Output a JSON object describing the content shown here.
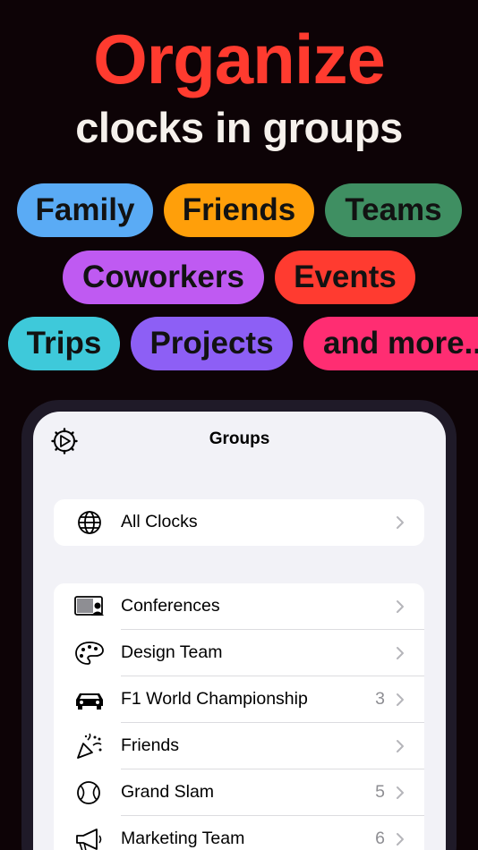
{
  "headline": "Organize",
  "subheadline": "clocks in groups",
  "tags": [
    {
      "label": "Family",
      "color": "#5aabf5"
    },
    {
      "label": "Friends",
      "color": "#ff9f0a"
    },
    {
      "label": "Teams",
      "color": "#3f8f62"
    },
    {
      "label": "Coworkers",
      "color": "#bf5af2"
    },
    {
      "label": "Events",
      "color": "#ff3b30"
    },
    {
      "label": "Trips",
      "color": "#3ec9da"
    },
    {
      "label": "Projects",
      "color": "#8d5ff5"
    },
    {
      "label": "and more...",
      "color": "#ff2d72"
    }
  ],
  "screen": {
    "title": "Groups",
    "settings_icon": "gear-clock-icon",
    "all_clocks": {
      "label": "All Clocks",
      "icon": "globe-icon"
    },
    "groups": [
      {
        "label": "Conferences",
        "count": "",
        "icon": "presentation-icon"
      },
      {
        "label": "Design Team",
        "count": "",
        "icon": "palette-icon"
      },
      {
        "label": "F1 World Championship",
        "count": "3",
        "icon": "car-icon"
      },
      {
        "label": "Friends",
        "count": "",
        "icon": "party-popper-icon"
      },
      {
        "label": "Grand Slam",
        "count": "5",
        "icon": "tennis-ball-icon"
      },
      {
        "label": "Marketing Team",
        "count": "6",
        "icon": "megaphone-icon"
      }
    ]
  }
}
